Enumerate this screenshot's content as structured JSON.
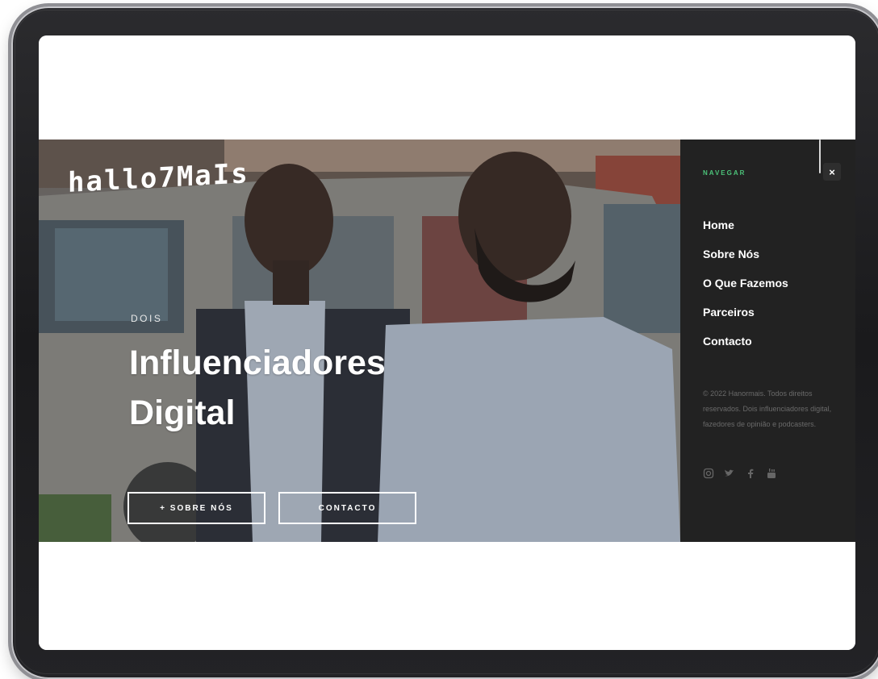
{
  "brand": {
    "logo_text": "hallo7MaIs"
  },
  "hero": {
    "eyebrow": "DOIS",
    "headline_line1": "Influenciadores",
    "headline_line2": "Digital",
    "buttons": {
      "about": "+ SOBRE NÓS",
      "contact": "CONTACTO"
    }
  },
  "nav": {
    "heading": "NAVEGAR",
    "close_label": "×",
    "items": [
      {
        "label": "Home"
      },
      {
        "label": "Sobre Nós"
      },
      {
        "label": "O Que Fazemos"
      },
      {
        "label": "Parceiros"
      },
      {
        "label": "Contacto"
      }
    ],
    "copyright": "© 2022 Hanormais. Todos direitos reservados. Dois influenciadores digital, fazedores de opinião e podcasters.",
    "socials": [
      "instagram-icon",
      "twitter-icon",
      "facebook-icon",
      "youtube-icon"
    ]
  },
  "colors": {
    "accent": "#4cc47a",
    "panel": "#222222",
    "text": "#ffffff",
    "muted": "#6a6a6a"
  }
}
